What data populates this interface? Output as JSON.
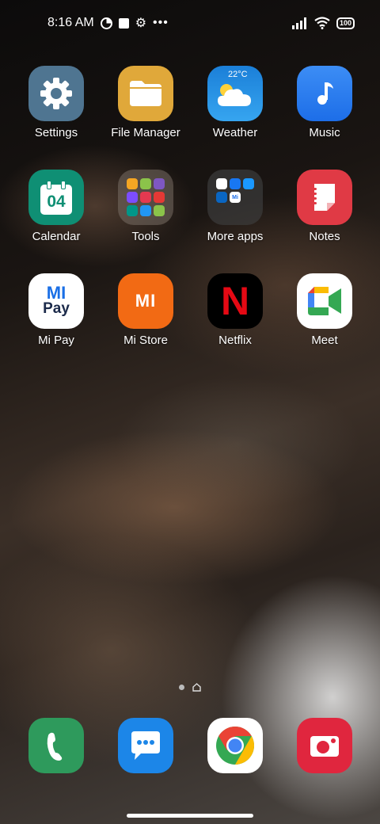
{
  "status": {
    "time": "8:16 AM",
    "battery": "100"
  },
  "apps": [
    {
      "label": "Settings",
      "icon": "gear-icon"
    },
    {
      "label": "File Manager",
      "icon": "folder-icon"
    },
    {
      "label": "Weather",
      "icon": "weather-icon",
      "temp": "22°C"
    },
    {
      "label": "Music",
      "icon": "music-note-icon"
    },
    {
      "label": "Calendar",
      "icon": "calendar-icon",
      "date": "04"
    },
    {
      "label": "Tools",
      "icon": "folder-icon"
    },
    {
      "label": "More apps",
      "icon": "folder-icon"
    },
    {
      "label": "Notes",
      "icon": "notes-icon"
    },
    {
      "label": "Mi Pay",
      "icon": "mi-pay-icon",
      "text1": "MI",
      "text2": "Pay"
    },
    {
      "label": "Mi Store",
      "icon": "mi-store-icon",
      "text": "MI"
    },
    {
      "label": "Netflix",
      "icon": "netflix-icon",
      "text": "N"
    },
    {
      "label": "Meet",
      "icon": "meet-icon"
    }
  ],
  "more_apps_folder": {
    "mini_label": "Mi"
  },
  "dock": [
    {
      "name": "phone",
      "icon": "phone-icon"
    },
    {
      "name": "messages",
      "icon": "message-icon"
    },
    {
      "name": "chrome",
      "icon": "chrome-icon"
    },
    {
      "name": "camera",
      "icon": "camera-icon"
    }
  ],
  "colors": {
    "settings": "#4f7591",
    "file_manager": "#e0a83a",
    "weather": "#1e8fe0",
    "music": "#2d7cf0",
    "calendar": "#0f8f74",
    "notes": "#e03a45",
    "mi_store": "#f26a14",
    "netflix_red": "#e50914",
    "phone": "#2e9a5c",
    "messages": "#1c86e8",
    "camera": "#e0263e"
  }
}
